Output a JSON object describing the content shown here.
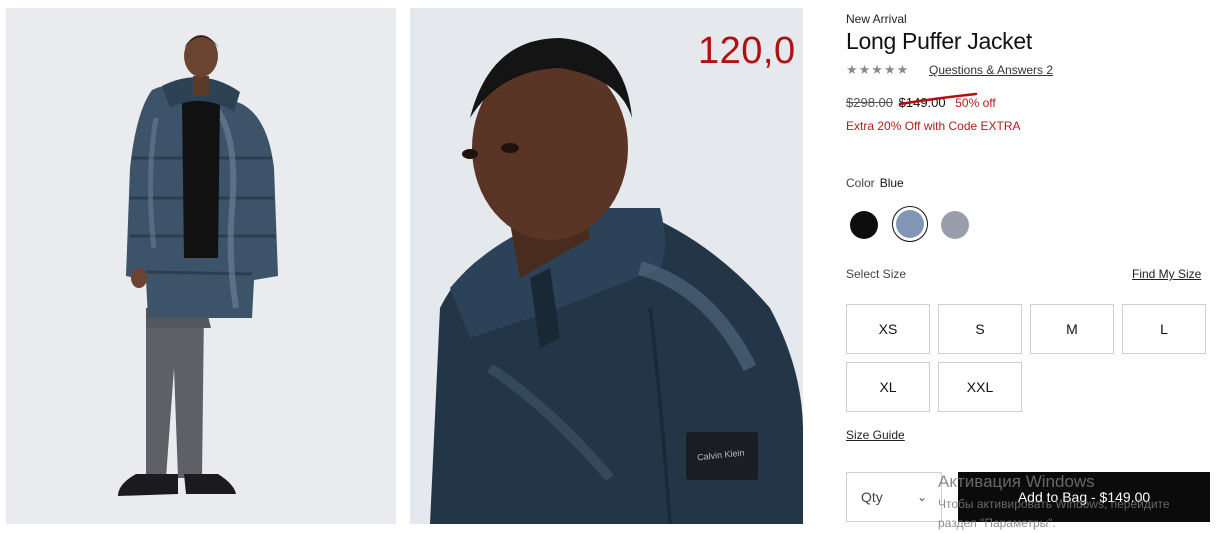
{
  "product": {
    "badge": "New Arrival",
    "title": "Long Puffer Jacket",
    "rating_stars": "★★★★★",
    "qa_link": "Questions & Answers 2",
    "price_original": "$298.00",
    "price_sale": "$149.00",
    "price_discount": "50% off",
    "promo": "Extra 20% Off with Code EXTRA",
    "color_label": "Color",
    "color_value": "Blue",
    "swatches": [
      {
        "name": "Black",
        "hex": "#0d0d0f"
      },
      {
        "name": "Blue",
        "hex": "#8196b4",
        "selected": true
      },
      {
        "name": "Grey",
        "hex": "#9a9eab"
      }
    ],
    "select_size_label": "Select Size",
    "find_size_link": "Find My Size",
    "sizes": [
      "XS",
      "S",
      "M",
      "L",
      "XL",
      "XXL"
    ],
    "size_guide_link": "Size Guide",
    "qty_label": "Qty",
    "add_to_bag": "Add to Bag - $149.00"
  },
  "annotation": {
    "handwritten_price": "120,0"
  },
  "images": {
    "full_body": "model wearing long navy puffer jacket, full body",
    "closeup": "close-up of model wearing puffer jacket with Calvin Klein patch",
    "patch_text": "Calvin Klein"
  },
  "watermark": {
    "title": "Активация Windows",
    "line1": "Чтобы активировать Windows, перейдите",
    "line2": "раздел \"Параметры\"."
  },
  "colors": {
    "sale_red": "#b51a1a",
    "button_black": "#0b0b0b"
  }
}
